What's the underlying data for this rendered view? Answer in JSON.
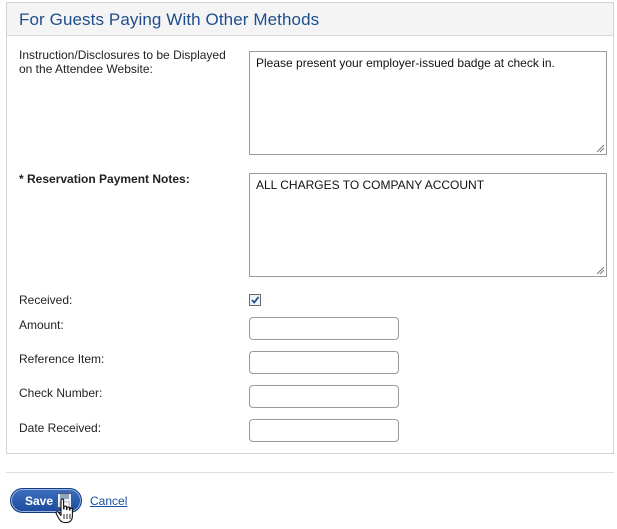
{
  "panel": {
    "title": "For Guests Paying With Other Methods"
  },
  "form": {
    "instructions": {
      "label_line1": "Instruction/Disclosures to be Displayed",
      "label_line2": "on the Attendee Website:",
      "value": "Please present your employer-issued badge at check in."
    },
    "payment_notes": {
      "label": "* Reservation Payment Notes:",
      "value": "ALL CHARGES TO COMPANY ACCOUNT"
    },
    "received": {
      "label": "Received:",
      "checked": true
    },
    "amount": {
      "label": "Amount:",
      "value": ""
    },
    "reference_item": {
      "label": "Reference Item:",
      "value": ""
    },
    "check_number": {
      "label": "Check Number:",
      "value": ""
    },
    "date_received": {
      "label": "Date Received:",
      "value": ""
    }
  },
  "actions": {
    "save_label": "Save",
    "cancel_label": "Cancel"
  },
  "icons": {
    "save": "floppy-disk-icon",
    "cursor": "hand-pointer-icon",
    "checkbox": "checkmark-icon",
    "resize": "resize-grip-icon"
  },
  "colors": {
    "title": "#1f4e8c",
    "button": "#1b4a9b",
    "link": "#1a4fa0"
  }
}
